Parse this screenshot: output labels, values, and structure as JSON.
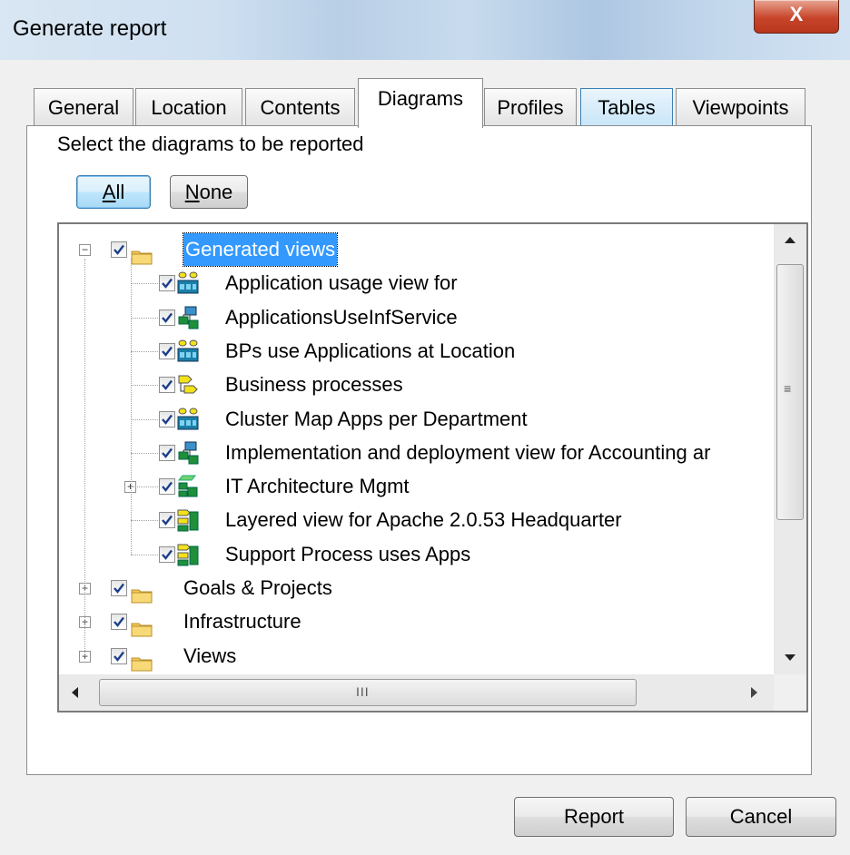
{
  "window": {
    "title": "Generate report",
    "close_glyph": "X"
  },
  "tabs": [
    {
      "label": "General",
      "state": "normal"
    },
    {
      "label": "Location",
      "state": "normal"
    },
    {
      "label": "Contents",
      "state": "normal"
    },
    {
      "label": "Diagrams",
      "state": "active"
    },
    {
      "label": "Profiles",
      "state": "normal"
    },
    {
      "label": "Tables",
      "state": "hover"
    },
    {
      "label": "Viewpoints",
      "state": "normal"
    }
  ],
  "diagrams_tab": {
    "instruction": "Select the diagrams to be reported",
    "all_button": {
      "label": "All",
      "mnemonic": "A"
    },
    "none_button": {
      "label": "None",
      "mnemonic": "N"
    }
  },
  "tree": {
    "folders": [
      {
        "label": "Generated views",
        "checked": true,
        "expanded": true,
        "selected": true,
        "icon": "folder-icon",
        "children": [
          {
            "label": "Application usage view for",
            "checked": true,
            "icon": "cluster-map-icon"
          },
          {
            "label": "ApplicationsUseInfService",
            "checked": true,
            "icon": "application-diagram-icon"
          },
          {
            "label": "BPs use Applications at Location",
            "checked": true,
            "icon": "cluster-map-icon"
          },
          {
            "label": "Business processes",
            "checked": true,
            "icon": "business-process-icon"
          },
          {
            "label": "Cluster Map Apps per Department",
            "checked": true,
            "icon": "cluster-map-icon"
          },
          {
            "label": "Implementation and deployment view for Accounting ar",
            "checked": true,
            "icon": "application-diagram-icon"
          },
          {
            "label": "IT Architecture Mgmt",
            "checked": true,
            "icon": "architecture-icon",
            "expandable": true
          },
          {
            "label": "Layered view for Apache 2.0.53 Headquarter",
            "checked": true,
            "icon": "layered-view-icon"
          },
          {
            "label": "Support Process uses Apps",
            "checked": true,
            "icon": "layered-view-icon"
          }
        ]
      },
      {
        "label": "Goals & Projects",
        "checked": true,
        "expanded": false,
        "icon": "folder-icon"
      },
      {
        "label": "Infrastructure",
        "checked": true,
        "expanded": false,
        "icon": "folder-icon"
      },
      {
        "label": "Views",
        "checked": true,
        "expanded": false,
        "icon": "folder-icon"
      }
    ]
  },
  "scrollbars": {
    "grip_glyph_vertical": "≡",
    "grip_glyph_horizontal": "III"
  },
  "footer": {
    "report_button": "Report",
    "cancel_button": "Cancel"
  },
  "colors": {
    "selection": "#3399ff",
    "check": "#1d3f8a",
    "folder": "#f0c95a"
  }
}
